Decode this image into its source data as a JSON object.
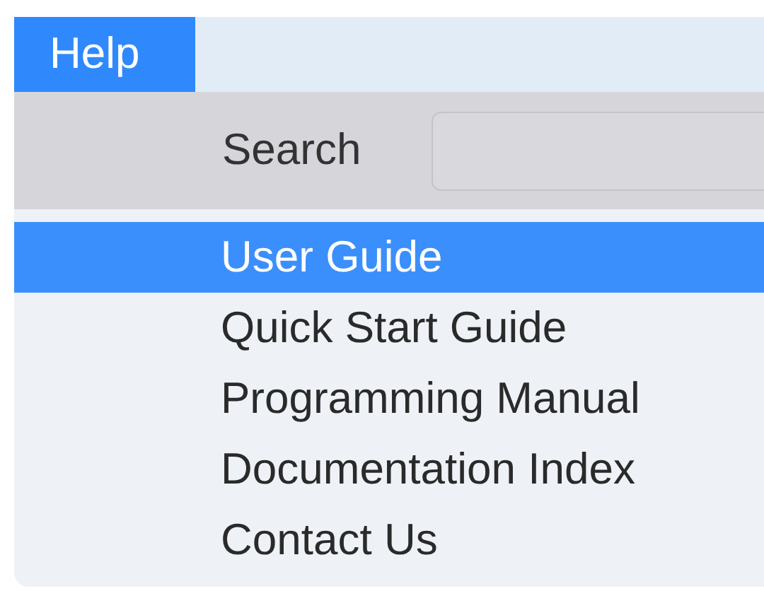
{
  "menu_bar": [
    {
      "label": "Help",
      "selected": true
    }
  ],
  "search": {
    "label": "Search"
  },
  "menu_items": [
    {
      "label": "User Guide",
      "selected": true
    },
    {
      "label": "Quick Start Guide",
      "selected": false
    },
    {
      "label": "Programming Manual",
      "selected": false
    },
    {
      "label": "Documentation Index",
      "selected": false
    },
    {
      "label": "Contact Us",
      "selected": false
    }
  ]
}
